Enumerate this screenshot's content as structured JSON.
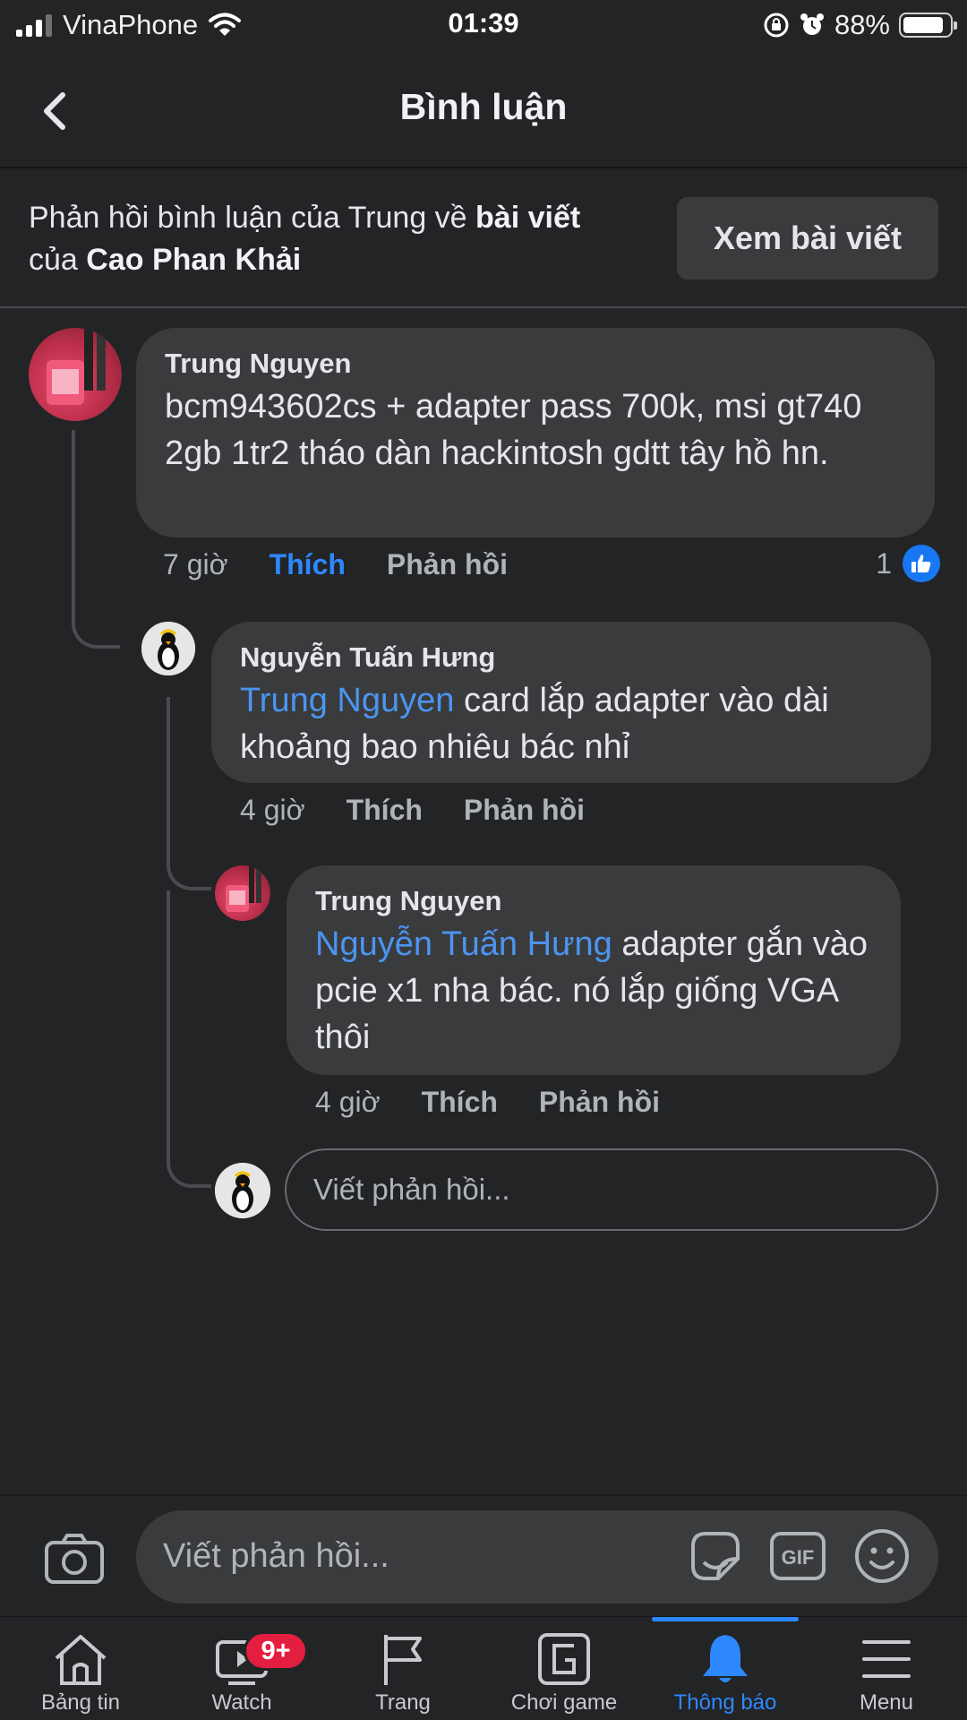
{
  "status_bar": {
    "carrier": "VinaPhone",
    "time": "01:39",
    "battery": "88%"
  },
  "header": {
    "title": "Bình luận"
  },
  "context": {
    "prefix": "Phản hồi bình luận của Trung về ",
    "post_link": "bài viết",
    "middle": "của ",
    "author": "Cao Phan Khải",
    "view_post_label": "Xem bài viết"
  },
  "comments": [
    {
      "author": "Trung Nguyen",
      "mention": "",
      "text": "bcm943602cs + adapter pass 700k, msi gt740 2gb 1tr2 tháo dàn hackintosh gdtt tây hồ hn.",
      "time": "7 giờ",
      "like_label": "Thích",
      "reply_label": "Phản hồi",
      "like_count": "1"
    },
    {
      "author": "Nguyễn Tuấn Hưng",
      "mention": "Trung Nguyen",
      "text": " card lắp adapter vào dài khoảng bao nhiêu bác nhỉ",
      "time": "4 giờ",
      "like_label": "Thích",
      "reply_label": "Phản hồi"
    },
    {
      "author": "Trung Nguyen",
      "mention": "Nguyễn Tuấn Hưng",
      "text": " adapter gắn vào pcie x1 nha bác. nó lắp giống VGA thôi",
      "time": "4 giờ",
      "like_label": "Thích",
      "reply_label": "Phản hồi"
    }
  ],
  "reply_input": {
    "placeholder": "Viết phản hồi..."
  },
  "composer": {
    "placeholder": "Viết phản hồi...",
    "gif_label": "GIF"
  },
  "tabbar": {
    "active_color": "#2d88ff",
    "items": [
      {
        "label": "Bảng tin",
        "icon": "home-icon"
      },
      {
        "label": "Watch",
        "icon": "watch-icon",
        "badge": "9+"
      },
      {
        "label": "Trang",
        "icon": "flag-icon"
      },
      {
        "label": "Chơi game",
        "icon": "gaming-icon"
      },
      {
        "label": "Thông báo",
        "icon": "bell-icon",
        "active": true
      },
      {
        "label": "Menu",
        "icon": "menu-icon"
      }
    ]
  }
}
